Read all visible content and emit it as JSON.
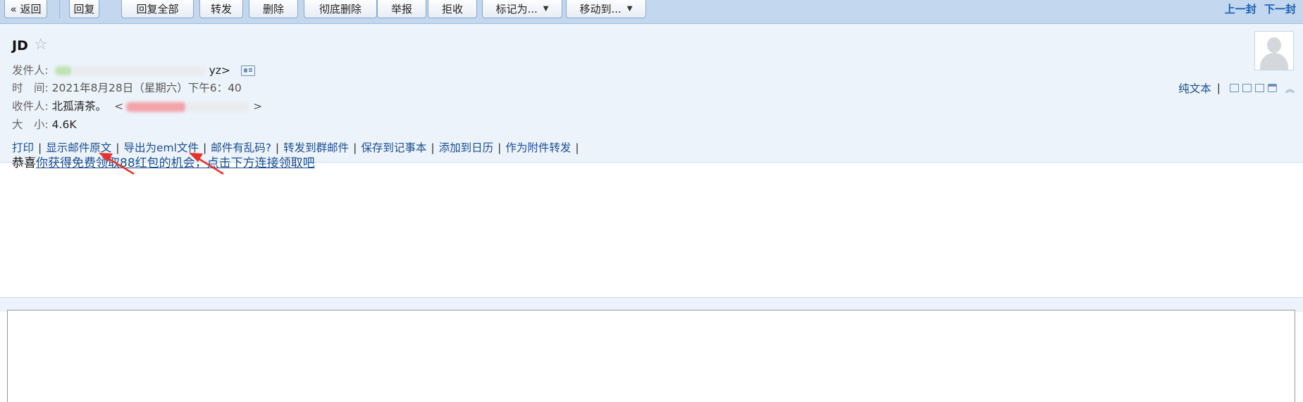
{
  "toolbar": {
    "back": "« 返回",
    "reply": "回复",
    "reply_all": "回复全部",
    "forward": "转发",
    "delete": "删除",
    "delete_forever": "彻底删除",
    "report": "举报",
    "reject": "拒收",
    "mark_as": "标记为...",
    "move_to": "移动到...",
    "prev": "上一封",
    "next": "下一封"
  },
  "mail": {
    "subject": "JD",
    "from_label": "发件人:",
    "from_value": "yz>",
    "time_label": "时　间:",
    "time_value": "2021年8月28日（星期六）下午6：40",
    "to_label": "收件人:",
    "to_name": "北孤清茶。",
    "to_open": "<",
    "to_close": ">",
    "size_label": "大　小:",
    "size_value": "4.6K"
  },
  "actions": {
    "print": "打印",
    "show_source": "显示邮件原文",
    "export_eml": "导出为eml文件",
    "garbled": "邮件有乱码?",
    "forward_group": "转发到群邮件",
    "save_note": "保存到记事本",
    "add_calendar": "添加到日历",
    "forward_attachment": "作为附件转发",
    "separator": "|"
  },
  "right_tools": {
    "plain_text": "纯文本",
    "separator": "|"
  },
  "body": {
    "prefix": "恭喜",
    "link_text": "你获得免费领取88红包的机会，点击下方连接领取吧"
  },
  "icons": [
    "star-icon",
    "contact-card-icon",
    "avatar-icon",
    "new-window-icon",
    "window-icon",
    "save-icon",
    "print-icon",
    "collapse-icon",
    "dropdown-caret-icon"
  ],
  "colors": {
    "toolbar_bg": "#c3d8ef",
    "header_bg": "#edf3fa",
    "link": "#1a4f8f",
    "annotation_arrow": "#e8312a"
  }
}
